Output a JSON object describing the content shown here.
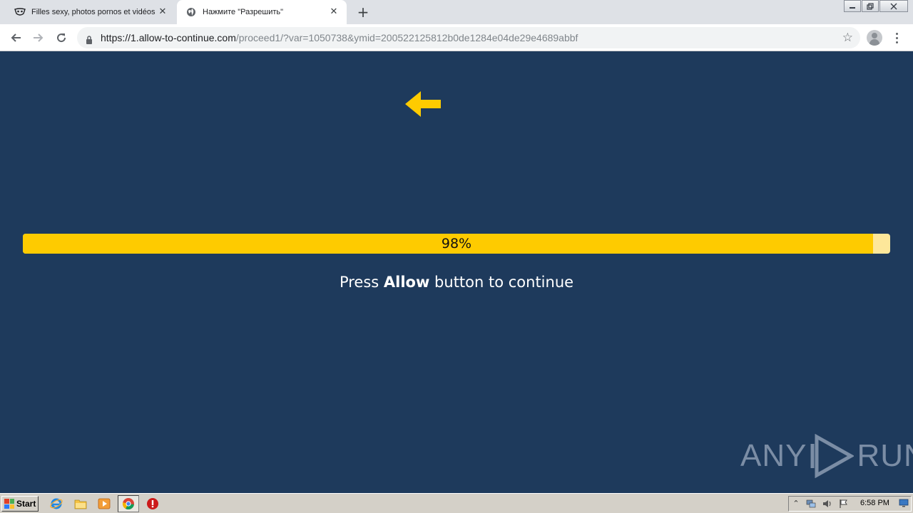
{
  "browser": {
    "tabs": [
      {
        "title": "Filles sexy, photos pornos et vidéos",
        "active": false,
        "icon": "mask-icon"
      },
      {
        "title": "Нажмите \"Разрешить\"",
        "active": true,
        "icon": "globe-icon"
      }
    ],
    "new_tab_label": "+",
    "close_label": "✕",
    "url_host": "https://1.allow-to-continue.com",
    "url_path": "/proceed1/?var=1050738&ymid=200522125812b0de1284e04de29e4689abbf"
  },
  "page": {
    "progress_value": 0.98,
    "progress_label": "98%",
    "message_prefix": "Press ",
    "message_bold": "Allow",
    "message_suffix": " button to continue",
    "accent_color": "#fecb00",
    "background_color": "#1e3a5c"
  },
  "watermark": {
    "left": "ANY",
    "right": "RUN"
  },
  "taskbar": {
    "start_label": "Start",
    "clock": "6:58 PM"
  }
}
